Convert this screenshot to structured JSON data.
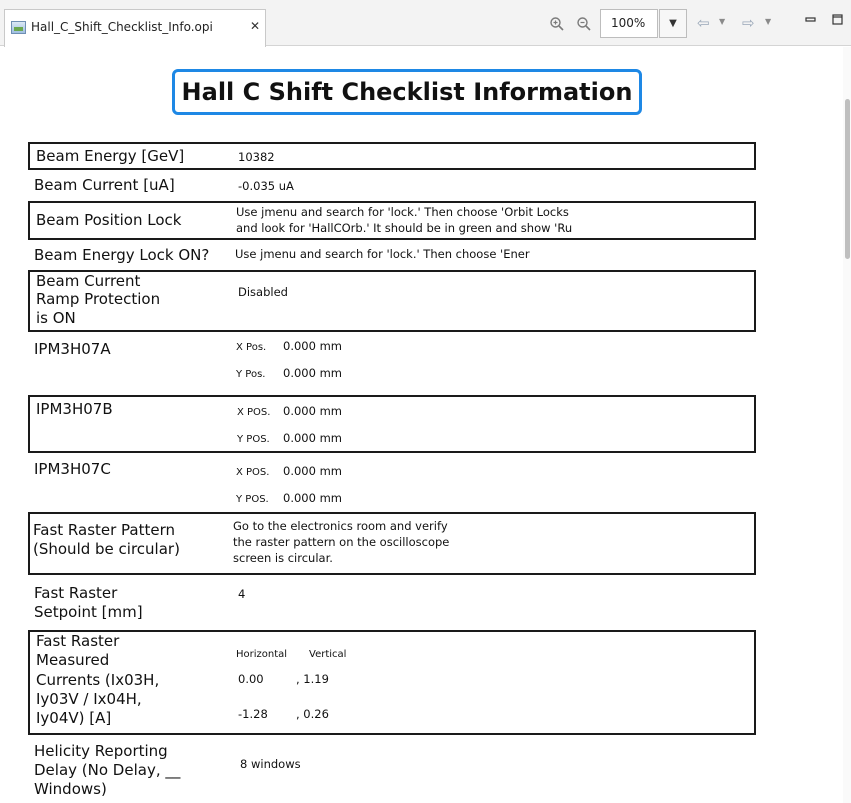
{
  "tab": {
    "title": "Hall_C_Shift_Checklist_Info.opi",
    "close_glyph": "✕",
    "icon": "opi-file-icon"
  },
  "toolbar": {
    "zoom_in_icon": "zoom-in-icon",
    "zoom_out_icon": "zoom-out-icon",
    "zoom_value": "100%",
    "back_icon": "back-arrow-icon",
    "forward_icon": "forward-arrow-icon",
    "minimize_icon": "minimize-icon",
    "maximize_icon": "maximize-icon"
  },
  "page": {
    "title": "Hall C Shift Checklist Information"
  },
  "rows": {
    "beam_energy": {
      "label": "Beam Energy [GeV]",
      "value": "10382"
    },
    "beam_current": {
      "label": "Beam Current [uA]",
      "value": "-0.035 uA"
    },
    "beam_position_lock": {
      "label": "Beam Position Lock",
      "line1": "Use jmenu and search for 'lock.' Then choose 'Orbit Locks",
      "line2": "and look for 'HallCOrb.' It should be in green and show 'Ru"
    },
    "beam_energy_lock": {
      "label": "Beam Energy Lock ON?",
      "value": "Use jmenu and search for 'lock.' Then choose 'Ener"
    },
    "ramp_protection": {
      "label_line1": "Beam Current",
      "label_line2": "Ramp Protection",
      "label_line3": "is ON",
      "value": "Disabled"
    },
    "ipm3h07a": {
      "label": "IPM3H07A",
      "x_label": "X Pos.",
      "x_value": "0.000 mm",
      "y_label": "Y Pos.",
      "y_value": "0.000 mm"
    },
    "ipm3h07b": {
      "label": "IPM3H07B",
      "x_label": "X POS.",
      "x_value": "0.000 mm",
      "y_label": "Y POS.",
      "y_value": "0.000 mm"
    },
    "ipm3h07c": {
      "label": "IPM3H07C",
      "x_label": "X POS.",
      "x_value": "0.000 mm",
      "y_label": "Y POS.",
      "y_value": "0.000 mm"
    },
    "fast_raster_pattern": {
      "label_line1": "Fast Raster Pattern",
      "label_line2": "(Should be circular)",
      "line1": "Go to the electronics room and verify",
      "line2": "the raster pattern on the oscilloscope",
      "line3": "screen is circular."
    },
    "fast_raster_setpoint": {
      "label_line1": "Fast Raster",
      "label_line2": "Setpoint [mm]",
      "value": "4"
    },
    "fast_raster_currents": {
      "label_line1": "Fast Raster",
      "label_line2": "Measured",
      "label_line3": "Currents (Ix03H,",
      "label_line4": "Iy03V / Ix04H,",
      "label_line5": "Iy04V) [A]",
      "col_horizontal": "Horizontal",
      "col_vertical": "Vertical",
      "r1_h": "0.00",
      "r1_v": ", 1.19",
      "r2_h": "-1.28",
      "r2_v": ", 0.26"
    },
    "helicity_delay": {
      "label_line1": "Helicity Reporting",
      "label_line2": "Delay (No Delay, __",
      "label_line3": "Windows)",
      "value": "8 windows"
    }
  }
}
